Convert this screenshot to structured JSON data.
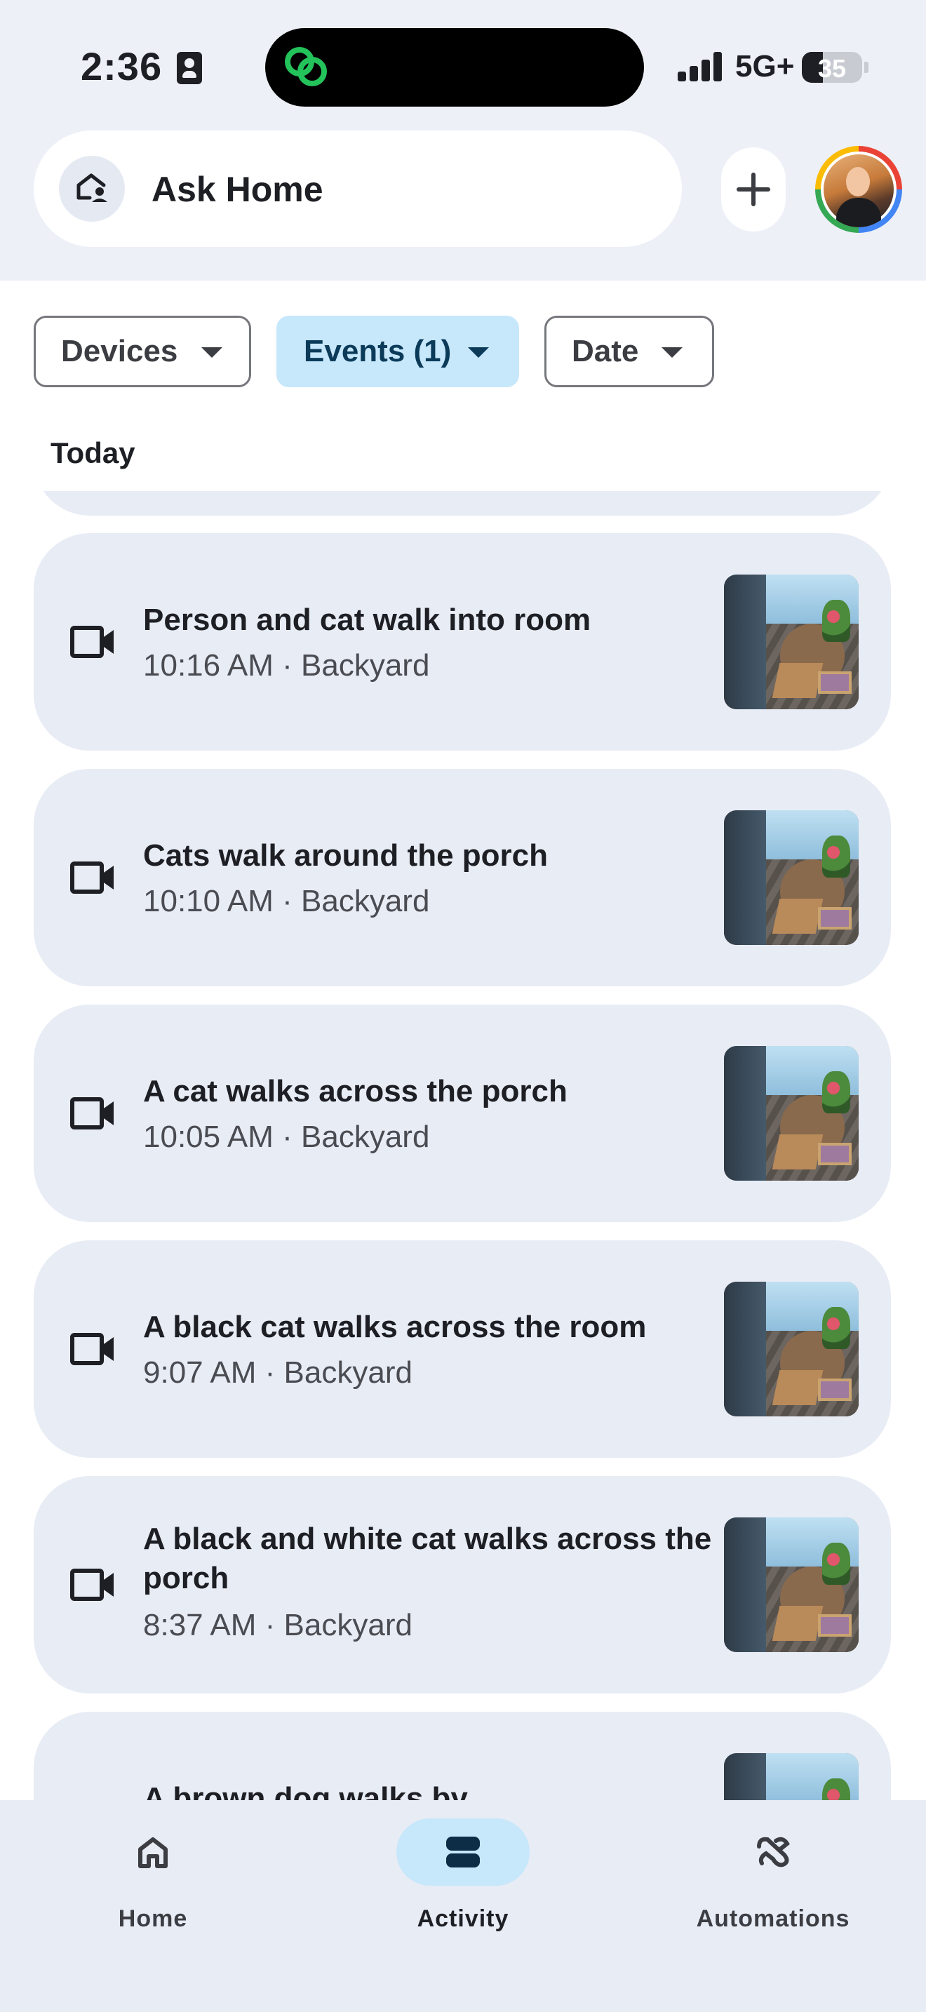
{
  "status_bar": {
    "time": "2:36",
    "network": "5G+",
    "battery": "35",
    "battery_level": 0.35
  },
  "header": {
    "search_label": "Ask Home",
    "icons": {
      "search": "home-person-icon",
      "add": "plus-icon"
    }
  },
  "filters": {
    "chips": [
      {
        "label": "Devices",
        "active": false
      },
      {
        "label": "Events (1)",
        "active": true
      },
      {
        "label": "Date",
        "active": false
      }
    ]
  },
  "section": {
    "label": "Today"
  },
  "events": [
    {
      "title": "Person and cat walk into room",
      "meta": "10:16 AM · Backyard"
    },
    {
      "title": "Cats walk around the porch",
      "meta": "10:10 AM · Backyard"
    },
    {
      "title": "A cat walks across the porch",
      "meta": "10:05 AM · Backyard"
    },
    {
      "title": "A black cat walks across the room",
      "meta": "9:07 AM · Backyard"
    },
    {
      "title": "A black and white cat walks across the porch",
      "meta": "8:37 AM · Backyard"
    },
    {
      "title": "A brown dog walks by",
      "meta": ""
    }
  ],
  "nav": {
    "items": [
      {
        "label": "Home",
        "icon": "home-icon",
        "active": false
      },
      {
        "label": "Activity",
        "icon": "activity-icon",
        "active": true
      },
      {
        "label": "Automations",
        "icon": "automations-icon",
        "active": false
      }
    ]
  },
  "colors": {
    "accent_chip": "#c7e7fb",
    "card_bg": "#e8ecf5",
    "header_bg": "#edf0f7"
  }
}
